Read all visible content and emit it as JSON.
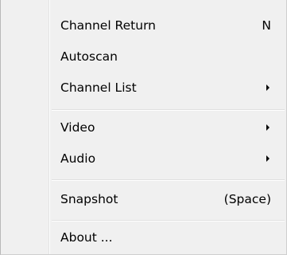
{
  "menu": {
    "items": [
      {
        "label": "Channel Return",
        "shortcut": "N"
      },
      {
        "label": "Autoscan",
        "shortcut": ""
      },
      {
        "label": "Channel List",
        "submenu": true
      },
      {
        "label": "Video",
        "submenu": true
      },
      {
        "label": "Audio",
        "submenu": true
      },
      {
        "label": "Snapshot",
        "shortcut": "(Space)"
      },
      {
        "label": "About ..."
      }
    ]
  },
  "colors": {
    "background": "#f0f0f0",
    "text": "#000000",
    "separator": "#e0e0e0"
  },
  "icons": {
    "submenu": "chevron-right-icon"
  }
}
